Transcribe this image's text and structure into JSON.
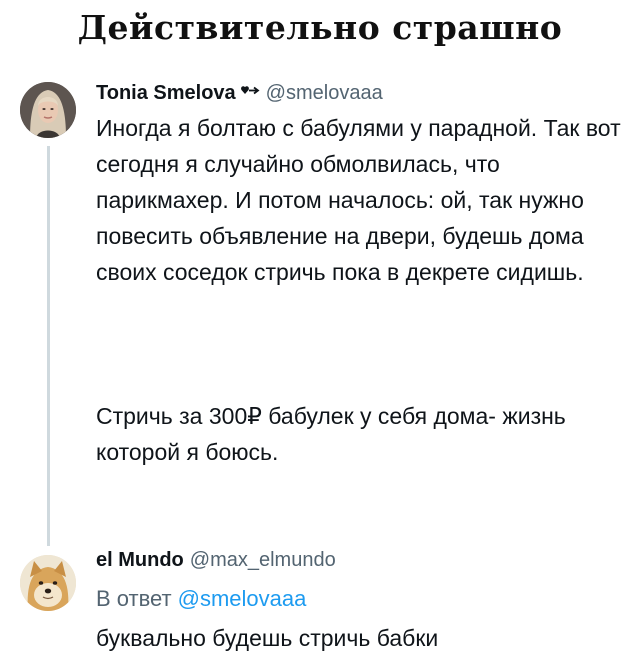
{
  "meme": {
    "title": "Действительно страшно"
  },
  "tweet1": {
    "display_name": "Tonia Smelova",
    "handle": "@smelovaaa",
    "badge_icon": "heart-arrow-icon",
    "paragraph1": "Иногда я болтаю с бабулями у парадной. Так вот сегодня я случайно обмолвилась, что парикмахер. И потом началось: ой, так нужно повесить объявление на двери, будешь дома своих соседок стричь пока в декрете сидишь.",
    "paragraph2": "Стричь за 300₽ бабулек у себя дома- жизнь которой я боюсь."
  },
  "tweet2": {
    "display_name": "el Mundo",
    "handle": "@max_elmundo",
    "reply_prefix": "В ответ",
    "reply_mention": "@smelovaaa",
    "text": "буквально будешь стричь бабки"
  },
  "colors": {
    "text": "#0f1419",
    "secondary": "#536471",
    "link": "#1d9bf0",
    "thread_line": "#cfd9de"
  }
}
